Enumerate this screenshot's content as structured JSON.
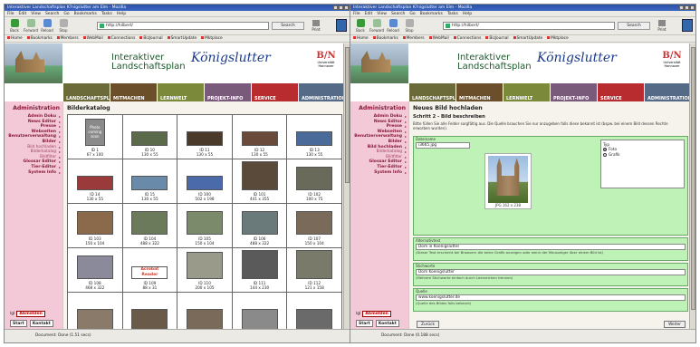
{
  "browser": {
    "title": "Interaktiver Landschaftsplan K?nigslutter am Elm - Mozilla",
    "menu": [
      "File",
      "Edit",
      "View",
      "Search",
      "Go",
      "Bookmarks",
      "Tasks",
      "Help"
    ],
    "nav": {
      "back": "Back",
      "forward": "Forward",
      "reload": "Reload",
      "stop": "Stop",
      "print": "Print"
    },
    "url": "http://hilbert/",
    "search": "Search",
    "bookmarks": [
      "Home",
      "Bookmarks",
      "Members",
      "WebMail",
      "Connections",
      "BizJournal",
      "SmartUpdate",
      "Mktplace"
    ],
    "status1": "Document: Done (1.51 secs)",
    "status2": "Document: Done (0.188 secs)"
  },
  "site": {
    "title_line1": "Interaktiver",
    "title_line2": "Landschaftsplan",
    "brand": "Königslutter",
    "brand_sub": "am Elm",
    "partner": "B/N",
    "partner_sub": "Universität Hannover",
    "tabs": [
      "LANDSCHAFTSPLAN",
      "MITMACHEN",
      "LERNWELT",
      "PROJEKT-INFO",
      "SERVICE",
      "ADMINISTRATION"
    ],
    "tab_colors": [
      "#6b6b3a",
      "#6a4f2a",
      "#7a8a3a",
      "#7a5a7a",
      "#b82c30",
      "#546a86"
    ]
  },
  "sidebar": {
    "heading": "Administration",
    "items": [
      {
        "l": "Admin Doku"
      },
      {
        "l": "News Editor"
      },
      {
        "l": "Presse"
      },
      {
        "l": "Webseiten"
      },
      {
        "l": "Benutzerverwaltung"
      },
      {
        "l": "Bilder"
      },
      {
        "l": "Bild hochladen",
        "sub": true
      },
      {
        "l": "Bilderkatalog",
        "sub": true
      },
      {
        "l": "Bildfilter",
        "sub": true
      },
      {
        "l": "Glossar Editor"
      },
      {
        "l": "Tier-Editor"
      },
      {
        "l": "System Info"
      }
    ],
    "items2": [
      {
        "l": "Admin Doku"
      },
      {
        "l": "News Editor"
      },
      {
        "l": "Presse"
      },
      {
        "l": "Webseiten"
      },
      {
        "l": "Benutzerverwaltung"
      },
      {
        "l": "Bilder"
      },
      {
        "l": "Bild hochladen"
      },
      {
        "l": "Bilderkatalog",
        "sub": true
      },
      {
        "l": "Bildfilter",
        "sub": true
      },
      {
        "l": "Glossar Editor"
      },
      {
        "l": "Tier-Editor"
      },
      {
        "l": "System Info"
      }
    ],
    "user": "lgl",
    "logout": "Abmelden",
    "start": "Start",
    "contact": "Kontakt"
  },
  "catalog": {
    "heading": "Bilderkatalog",
    "items": [
      {
        "id": "ID 1",
        "size": "67 x 100",
        "c": "#8a8a8a",
        "h": 30
      },
      {
        "id": "ID 10",
        "size": "130 x 55",
        "c": "#5a6a4a",
        "h": 16
      },
      {
        "id": "ID 11",
        "size": "130 x 55",
        "c": "#4a3a2a",
        "h": 16
      },
      {
        "id": "ID 12",
        "size": "130 x 55",
        "c": "#6a4a3a",
        "h": 16
      },
      {
        "id": "ID 13",
        "size": "130 x 55",
        "c": "#4a6a9a",
        "h": 16
      },
      {
        "id": "ID 14",
        "size": "130 x 55",
        "c": "#9a3a3a",
        "h": 16
      },
      {
        "id": "ID 15",
        "size": "130 x 55",
        "c": "#6a8aaa",
        "h": 16
      },
      {
        "id": "ID 100",
        "size": "502 x 198",
        "c": "#4a6aaa",
        "h": 16
      },
      {
        "id": "ID 101",
        "size": "441 x 355",
        "c": "#5a4a3a",
        "h": 32
      },
      {
        "id": "ID 102",
        "size": "100 x 75",
        "c": "#6a6a5a",
        "h": 26
      },
      {
        "id": "ID 103",
        "size": "150 x 104",
        "c": "#8a6a4a",
        "h": 26
      },
      {
        "id": "ID 104",
        "size": "488 x 322",
        "c": "#6a7a5a",
        "h": 26
      },
      {
        "id": "ID 105",
        "size": "150 x 104",
        "c": "#7a8a6a",
        "h": 26
      },
      {
        "id": "ID 106",
        "size": "488 x 322",
        "c": "#6a7a7a",
        "h": 26
      },
      {
        "id": "ID 107",
        "size": "150 x 104",
        "c": "#7a6a5a",
        "h": 26
      },
      {
        "id": "ID 108",
        "size": "468 x 322",
        "c": "#8a8a9a",
        "h": 26
      },
      {
        "id": "ID 109",
        "size": "88 x 31",
        "c": "#cc3a2a",
        "h": 14,
        "txt": "Acrobat Reader"
      },
      {
        "id": "ID 110",
        "size": "200 x 105",
        "c": "#9a9a8a",
        "h": 30
      },
      {
        "id": "ID 111",
        "size": "144 x 230",
        "c": "#5a5a5a",
        "h": 32
      },
      {
        "id": "ID 112",
        "size": "121 x 158",
        "c": "#7a7a6a",
        "h": 32
      },
      {
        "id": "",
        "size": "",
        "c": "#8a7a6a",
        "h": 26
      },
      {
        "id": "",
        "size": "",
        "c": "#6a5a4a",
        "h": 26
      },
      {
        "id": "",
        "size": "",
        "c": "#7a6a5a",
        "h": 26
      },
      {
        "id": "",
        "size": "",
        "c": "#8a8a8a",
        "h": 26
      },
      {
        "id": "",
        "size": "",
        "c": "#6a6a6a",
        "h": 26
      }
    ],
    "placeholder_text": "Photo coming soon"
  },
  "upload": {
    "heading": "Neues Bild hochladen",
    "step": "Schritt 2 - Bild beschreiben",
    "intro": "Bitte füllen Sie alle Felder sorgfältig aus. Die Quelle brauchen Sie nur anzugeben falls diese bekannt ist (bspw. bei einem Bild dessen Rechte erworben wurden).",
    "file_label": "Dateiname",
    "file_value": "i3665.jpg",
    "preview_caption": "JPG 162 x 238",
    "type_label": "Typ",
    "types": [
      "Foto",
      "Grafik"
    ],
    "alt_label": "Alternativtext",
    "alt_value": "Dom in Koenigslutter",
    "alt_hint": "(Dieser Text erscheint bei Browsern die keine Grafik anzeigen oder wenn der Mauszeiger über einem Bild ist)",
    "kw_label": "Stichworte",
    "kw_value": "Dom Koenigslutter",
    "kw_hint": "(Mehrere Stichworte einfach durch Leerzeichen trennen)",
    "src_label": "Quelle",
    "src_value": "www.koenigslutter.de",
    "src_hint": "(Quelle des Bildes falls bekannt)",
    "back": "Zurück",
    "next": "Weiter"
  }
}
